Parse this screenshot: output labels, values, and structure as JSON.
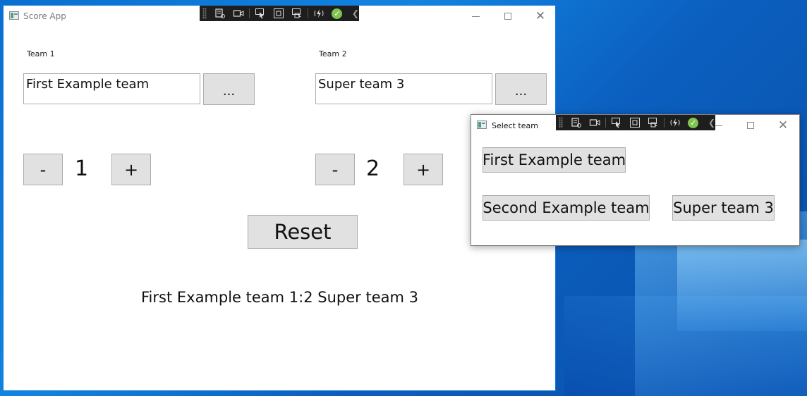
{
  "main_window": {
    "title": "Score App",
    "team1": {
      "label": "Team 1",
      "name_value": "First Example team",
      "browse_label": "...",
      "minus_label": "-",
      "score": "1",
      "plus_label": "+"
    },
    "team2": {
      "label": "Team 2",
      "name_value": "Super team 3",
      "browse_label": "...",
      "minus_label": "-",
      "score": "2",
      "plus_label": "+"
    },
    "reset_label": "Reset",
    "result": "First Example team 1:2 Super team 3"
  },
  "dialog": {
    "title": "Select team",
    "teams": [
      "First Example team",
      "Second Example team",
      "Super team 3"
    ]
  },
  "debug_toolbar": {
    "icons": [
      "go-to-live-visual-tree-icon",
      "record-icon",
      "select-element-icon",
      "display-layout-adorners-icon",
      "track-focused-element-icon",
      "hot-reload-icon",
      "binding-check-icon",
      "collapse-chevron-icon"
    ]
  }
}
